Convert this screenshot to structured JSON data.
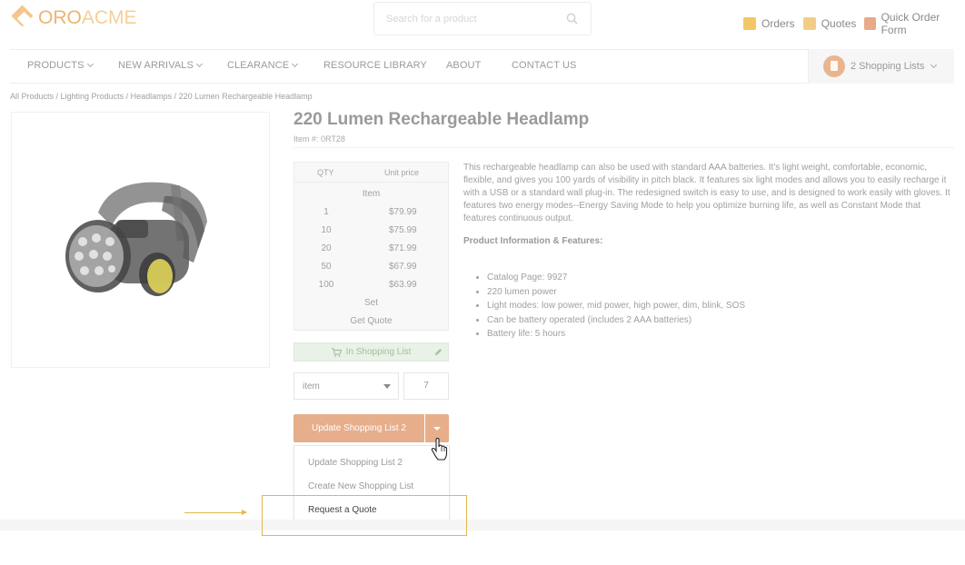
{
  "header": {
    "logo_text_1": "ORO",
    "logo_text_2": "ACME",
    "search_placeholder": "Search for a product",
    "links": [
      {
        "label": "Orders",
        "color": "#f0c060"
      },
      {
        "label": "Quotes",
        "color": "#f0c070"
      },
      {
        "label": "Quick Order Form",
        "color": "#e6a07a"
      }
    ]
  },
  "nav": {
    "items": [
      {
        "label": "PRODUCTS",
        "has_chevron": true
      },
      {
        "label": "NEW ARRIVALS",
        "has_chevron": true
      },
      {
        "label": "CLEARANCE",
        "has_chevron": true
      },
      {
        "label": "RESOURCE LIBRARY",
        "has_chevron": false
      },
      {
        "label": "ABOUT",
        "has_chevron": false
      },
      {
        "label": "CONTACT US",
        "has_chevron": false
      }
    ],
    "shopping_lists_label": "2 Shopping Lists"
  },
  "breadcrumb": "All Products / Lighting Products / Headlamps / 220 Lumen Rechargeable Headlamp",
  "product": {
    "title": "220 Lumen Rechargeable Headlamp",
    "item_number": "Item #: 0RT28",
    "price_table": {
      "col_qty": "QTY",
      "col_price": "Unit price",
      "unit_item": "Item",
      "rows": [
        {
          "qty": "1",
          "price": "$79.99"
        },
        {
          "qty": "10",
          "price": "$75.99"
        },
        {
          "qty": "20",
          "price": "$71.99"
        },
        {
          "qty": "50",
          "price": "$67.99"
        },
        {
          "qty": "100",
          "price": "$63.99"
        }
      ],
      "unit_set": "Set",
      "get_quote": "Get Quote"
    },
    "in_shopping_list": "In Shopping List",
    "unit_select_value": "item",
    "quantity": "7",
    "main_button": "Update Shopping List 2",
    "dropdown": [
      "Update Shopping List 2",
      "Create New Shopping List",
      "Request a Quote"
    ],
    "description": "This rechargeable headlamp can also be used with standard AAA batteries. It's light weight, comfortable, economic, flexible, and gives you 100 yards of visibility in pitch black. It features six light modes and allows you to easily recharge it with a USB or a standard wall plug-in. The redesigned switch is easy to use, and is designed to work easily with gloves. It features two energy modes--Energy Saving Mode to help you optimize burning life, as well as Constant Mode that features continuous output.",
    "features_heading": "Product Information & Features:",
    "features": [
      "Catalog Page: 9927",
      "220 lumen power",
      "Light modes: low power, mid power, high power, dim, blink, SOS",
      "Can be battery operated (includes 2 AAA batteries)",
      "Battery life: 5 hours"
    ]
  },
  "colors": {
    "accent": "#e6ae8b",
    "highlight": "#e3b84a",
    "in_list_bg": "#e8f2e6"
  }
}
